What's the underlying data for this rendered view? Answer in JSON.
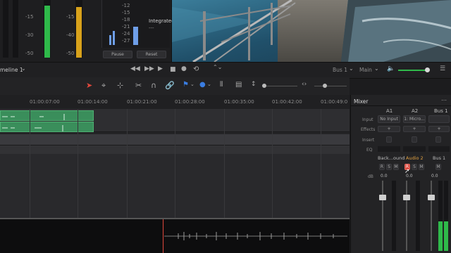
{
  "meters": {
    "scale_left": [
      "-5",
      "-10",
      "-15",
      "-20",
      "-30",
      "-40",
      "-50"
    ],
    "scale_right": [
      "-12",
      "-15",
      "-18",
      "-21",
      "-24",
      "-27",
      "-30"
    ],
    "integrated_label": "Integrated",
    "integrated_value": "---",
    "pause_label": "Pause",
    "reset_label": "Reset"
  },
  "transport": {
    "timeline_name": "meline 1",
    "bus_label": "Bus 1",
    "main_label": "Main",
    "volume_level": 0.85
  },
  "ruler": {
    "ticks": [
      "01:00:07:00",
      "01:00:14:00",
      "01:00:21:00",
      "01:00:28:00",
      "01:00:35:00",
      "01:00:42:00",
      "01:00:49:0"
    ]
  },
  "mixer": {
    "title": "Mixer",
    "row_labels": {
      "input": "Input",
      "effects": "Effects",
      "insert": "Insert",
      "eq": "EQ",
      "db": "dB"
    },
    "columns": [
      {
        "id": "A1",
        "input": "No Input",
        "name": "Back...ound",
        "db": "0.0",
        "buttons": [
          "R",
          "S",
          "M"
        ]
      },
      {
        "id": "A2",
        "input": "1: Micro...",
        "name": "Audio 2",
        "db": "0.0",
        "buttons": [
          "R",
          "S",
          "M"
        ]
      },
      {
        "id": "Bus1",
        "input": "",
        "name": "Bus 1",
        "db": "0.0",
        "buttons": [
          "M"
        ]
      }
    ],
    "column_headers": [
      "A1",
      "A2",
      "Bus1"
    ]
  },
  "colors": {
    "accent": "#e0a040",
    "clip_green": "#3a8e5b",
    "record_red": "#d9453a",
    "meter_green": "#2fb94a",
    "meter_yellow": "#d8a21b",
    "meter_blue": "#6e9ee8"
  }
}
